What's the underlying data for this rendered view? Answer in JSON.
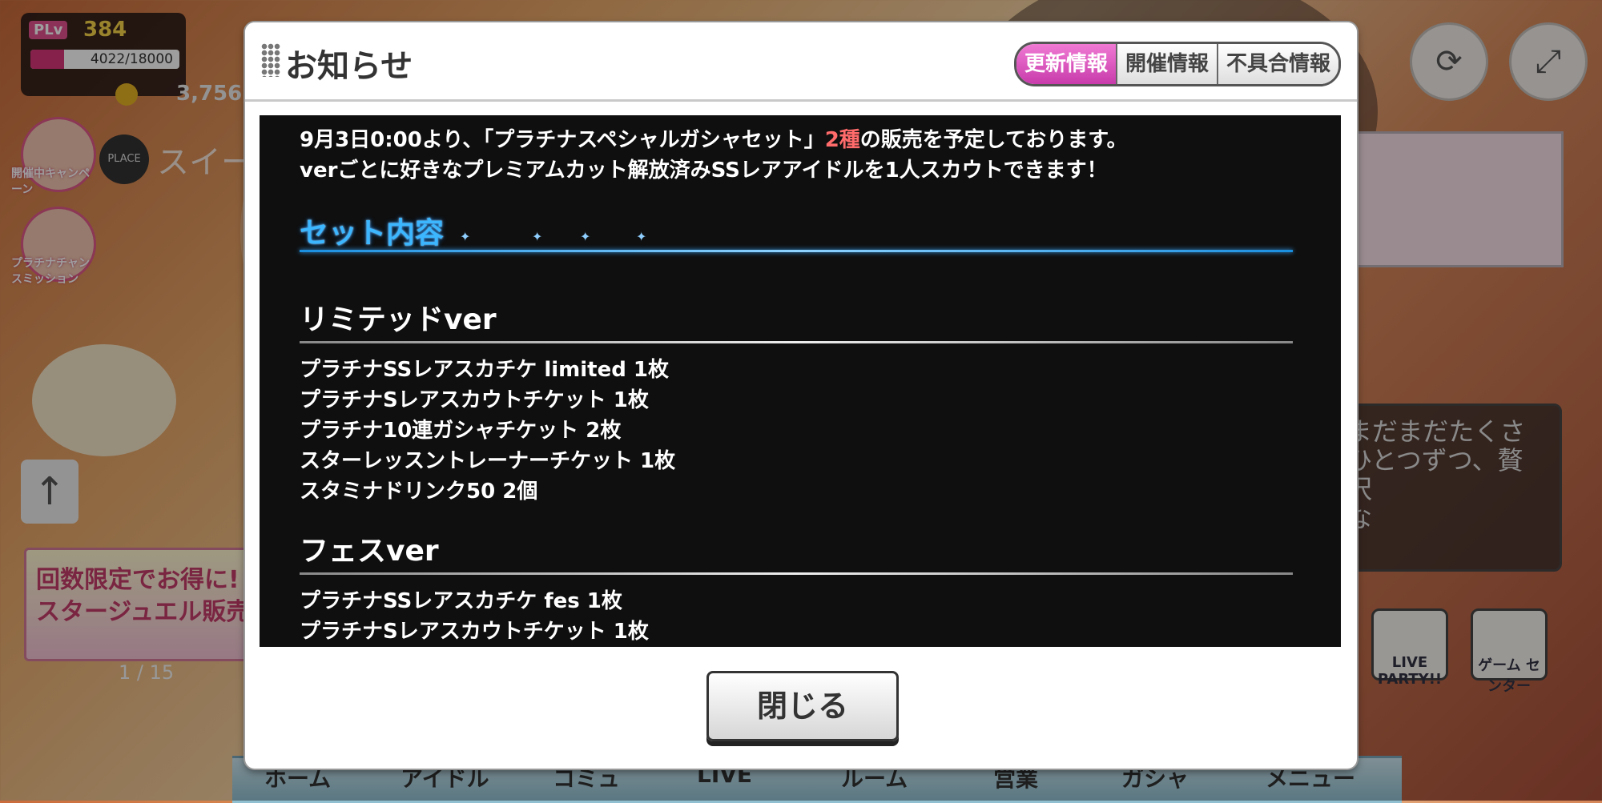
{
  "hud": {
    "plv_tag": "PLv",
    "plv_value": "384",
    "exp_text": "4022/18000",
    "exp_fraction": 0.2234,
    "money": "3,756,",
    "place_label": "PLACE",
    "place_text": "スイー"
  },
  "side_icons": [
    {
      "label": "開催中キャンペーン"
    },
    {
      "label": "プラチナチャンスミッション"
    }
  ],
  "banner": {
    "line1": "回数限定でお得に!",
    "line2": "スタージュエル販売",
    "page": "1 / 15"
  },
  "speech": {
    "text": "まだまだたくさ\nひとつずつ、贅沢\nな"
  },
  "game_buttons": [
    {
      "label": "LIVE PARTY!!"
    },
    {
      "label": "ゲーム センター"
    }
  ],
  "bottom_nav": [
    "ホーム",
    "アイドル",
    "コミュ",
    "LIVE",
    "ルーム",
    "営業",
    "ガシャ",
    "メニュー"
  ],
  "modal": {
    "title": "お知らせ",
    "tabs": [
      {
        "label": "更新情報",
        "active": true
      },
      {
        "label": "開催情報",
        "active": false
      },
      {
        "label": "不具合情報",
        "active": false
      }
    ],
    "intro_line1_a": "9月3日0:00より、「プラチナスペシャルガシャセット」",
    "intro_line1_hl": "2種",
    "intro_line1_b": "の販売を予定しております。",
    "intro_line2": "verごとに好きなプレミアムカット解放済みSSレアアイドルを1人スカウトできます！",
    "section_title": "セット内容",
    "groups": [
      {
        "title": "リミテッドver",
        "items": [
          "プラチナSSレアスカチケ limited 1枚",
          "プラチナSレアスカウトチケット 1枚",
          "プラチナ10連ガシャチケット 2枚",
          "スターレッスントレーナーチケット 1枚",
          "スタミナドリンク50 2個"
        ]
      },
      {
        "title": "フェスver",
        "items": [
          "プラチナSSレアスカチケ fes 1枚",
          "プラチナSレアスカウトチケット 1枚"
        ]
      }
    ],
    "close_label": "閉じる"
  },
  "colors": {
    "tab_active": "#d44dba",
    "highlight": "#ff6b6b",
    "section_head": "#3bb6ff"
  }
}
